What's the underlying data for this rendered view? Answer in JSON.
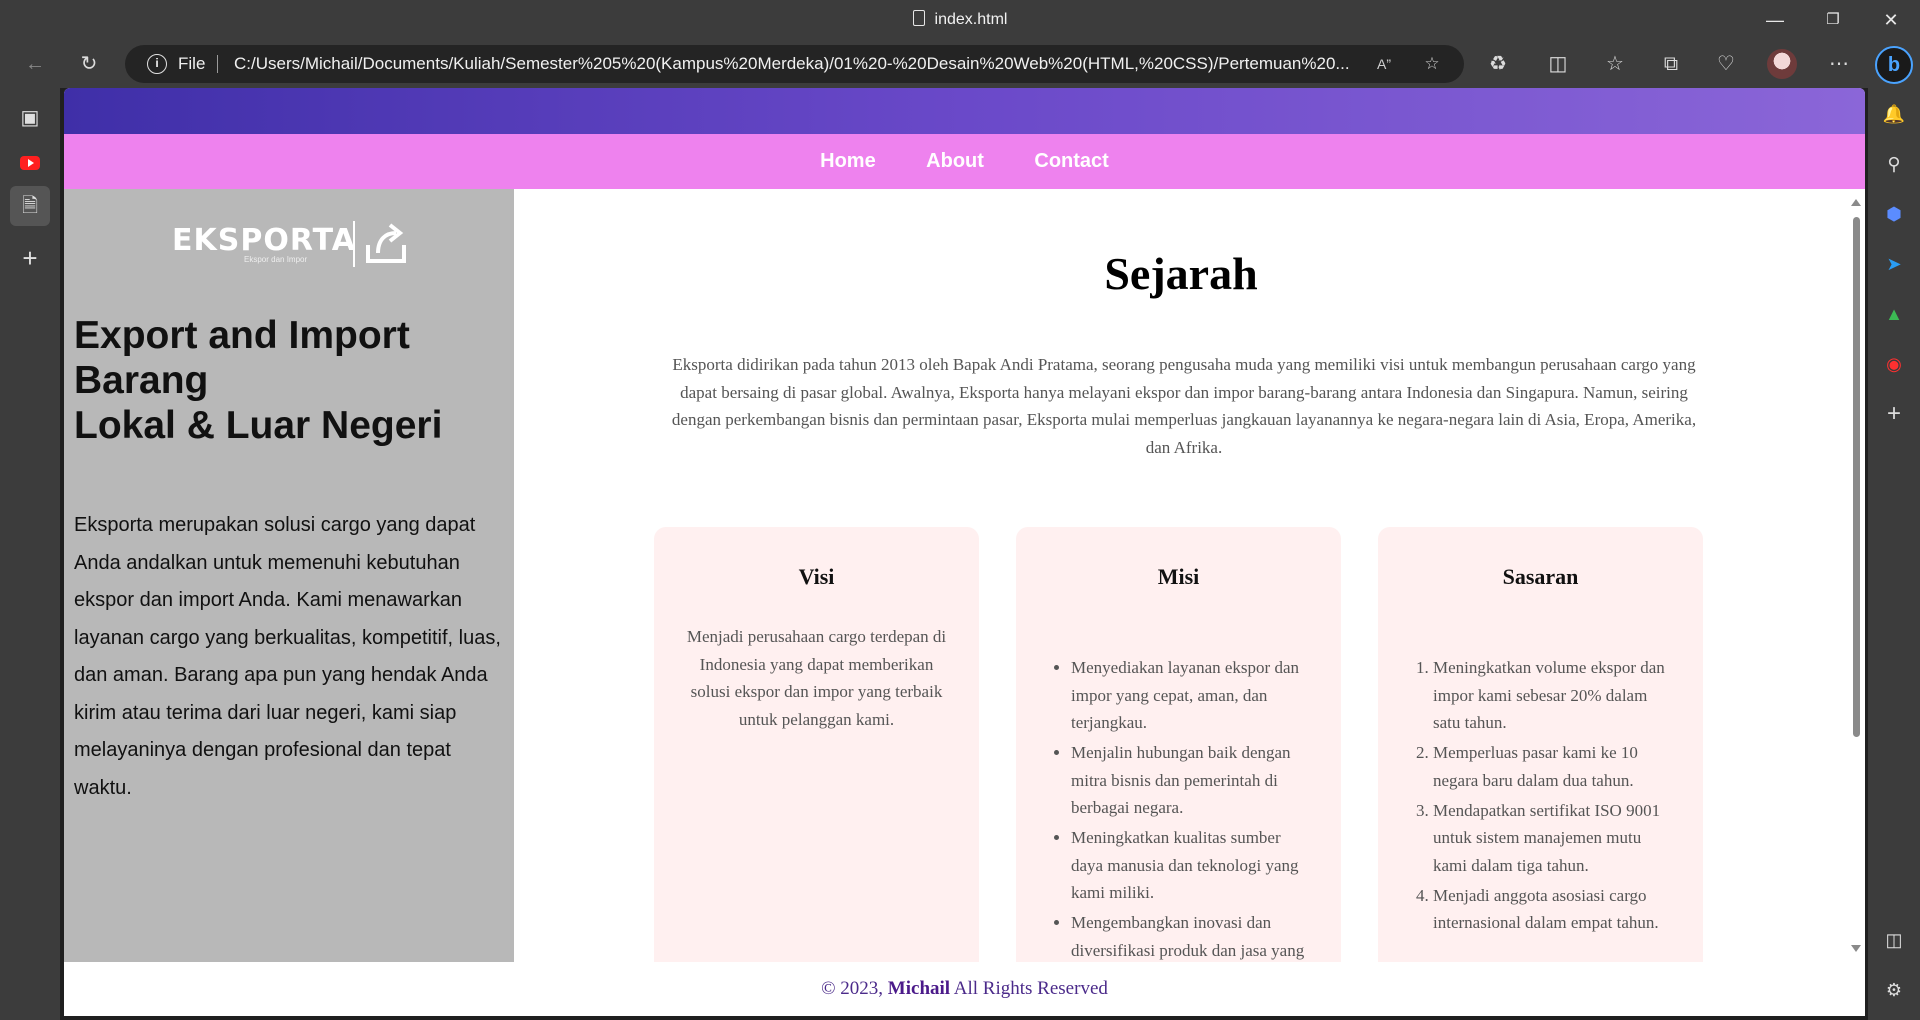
{
  "browser": {
    "tab_title": "index.html",
    "address": {
      "file_label": "File",
      "url": "C:/Users/Michail/Documents/Kuliah/Semester%205%20(Kampus%20Merdeka)/01%20-%20Desain%20Web%20(HTML,%20CSS)/Pertemuan%20..."
    },
    "icons": {
      "back": "back-arrow-icon",
      "refresh": "refresh-icon",
      "read_aloud": "read-aloud-icon",
      "favorite": "star-icon",
      "extensions": "puzzle-icon",
      "split": "split-screen-icon",
      "favorites": "favorites-icon",
      "collections": "collections-icon",
      "health": "browser-essentials-icon",
      "more": "more-icon"
    }
  },
  "nav": {
    "items": [
      "Home",
      "About",
      "Contact"
    ]
  },
  "aside": {
    "logo_text": "EKSPORTA",
    "logo_tagline": "Ekspor dan Impor",
    "heading_line1": "Export and Import",
    "heading_line2": "Barang",
    "heading_line3": "Lokal & Luar Negeri",
    "description": "Eksporta merupakan solusi cargo yang dapat Anda andalkan untuk memenuhi kebutuhan ekspor dan import Anda. Kami menawarkan layanan cargo yang berkualitas, kompetitif, luas, dan aman. Barang apa pun yang hendak Anda kirim atau terima dari luar negeri, kami siap melayaninya dengan profesional dan tepat waktu."
  },
  "main": {
    "title": "Sejarah",
    "intro": "Eksporta didirikan pada tahun 2013 oleh Bapak Andi Pratama, seorang pengusaha muda yang memiliki visi untuk membangun perusahaan cargo yang dapat bersaing di pasar global. Awalnya, Eksporta hanya melayani ekspor dan impor barang-barang antara Indonesia dan Singapura. Namun, seiring dengan perkembangan bisnis dan permintaan pasar, Eksporta mulai memperluas jangkauan layanannya ke negara-negara lain di Asia, Eropa, Amerika, dan Afrika.",
    "cards": [
      {
        "title": "Visi",
        "text": "Menjadi perusahaan cargo terdepan di Indonesia yang dapat memberikan solusi ekspor dan impor yang terbaik untuk pelanggan kami."
      },
      {
        "title": "Misi",
        "items": [
          "Menyediakan layanan ekspor dan impor yang cepat, aman, dan terjangkau.",
          "Menjalin hubungan baik dengan mitra bisnis dan pemerintah di berbagai negara.",
          "Meningkatkan kualitas sumber daya manusia dan teknologi yang kami miliki.",
          "Mengembangkan inovasi dan diversifikasi produk dan jasa yang"
        ]
      },
      {
        "title": "Sasaran",
        "items": [
          "Meningkatkan volume ekspor dan impor kami sebesar 20% dalam satu tahun.",
          "Memperluas pasar kami ke 10 negara baru dalam dua tahun.",
          "Mendapatkan sertifikat ISO 9001 untuk sistem manajemen mutu kami dalam tiga tahun.",
          "Menjadi anggota asosiasi cargo internasional dalam empat tahun."
        ]
      }
    ]
  },
  "footer": {
    "prefix": "© 2023,",
    "name": "Michail",
    "suffix": "All Rights Reserved"
  },
  "colors": {
    "nav_bg": "#ee82ee",
    "aside_bg": "#b8b8b8",
    "card_bg": "#fff0f0",
    "footer_text": "#4b2a8a"
  }
}
